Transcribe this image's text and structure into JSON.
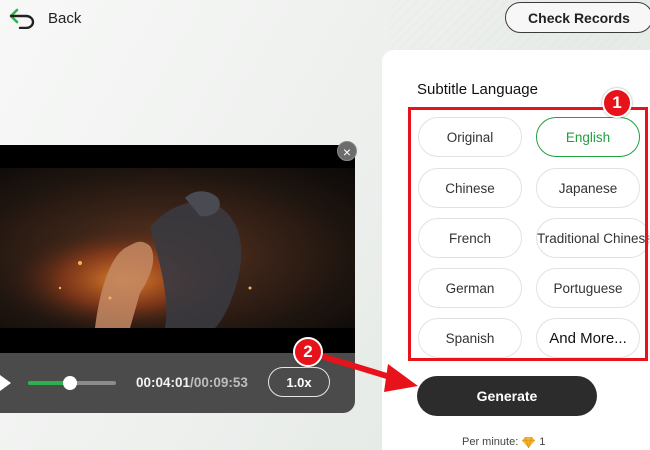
{
  "header": {
    "back_label": "Back",
    "check_records_label": "Check Records"
  },
  "player": {
    "current_time": "00:04:01",
    "separator": "/",
    "duration": "00:09:53",
    "speed": "1.0x",
    "progress_fraction": 0.475,
    "close_label": "×"
  },
  "settings": {
    "title": "Subtitle Language",
    "languages": [
      {
        "label": "Original",
        "selected": false
      },
      {
        "label": "English",
        "selected": true
      },
      {
        "label": "Chinese",
        "selected": false
      },
      {
        "label": "Japanese",
        "selected": false
      },
      {
        "label": "French",
        "selected": false
      },
      {
        "label": "Traditional Chinese",
        "selected": false
      },
      {
        "label": "German",
        "selected": false
      },
      {
        "label": "Portuguese",
        "selected": false
      },
      {
        "label": "Spanish",
        "selected": false
      },
      {
        "label": "And More...",
        "selected": false
      }
    ],
    "generate_label": "Generate",
    "per_minute_label": "Per minute:",
    "per_minute_cost": "1"
  },
  "annotations": {
    "step1": "1",
    "step2": "2"
  },
  "colors": {
    "accent_green": "#22a03e",
    "annotation_red": "#e8131a",
    "generate_bg": "#2c2c2c",
    "gem": "#f2b233"
  },
  "icons": {
    "back": "back-arrow-icon",
    "play": "play-icon",
    "close": "close-icon",
    "gem": "gem-icon"
  }
}
